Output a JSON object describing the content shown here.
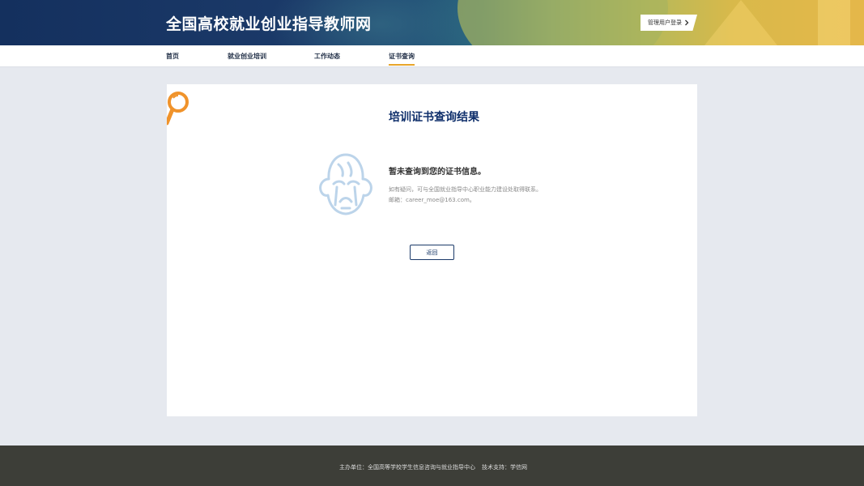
{
  "header": {
    "site_title": "全国高校就业创业指导教师网",
    "admin_login_label": "管理用户登录"
  },
  "nav": {
    "items": [
      {
        "label": "首页"
      },
      {
        "label": "就业创业培训"
      },
      {
        "label": "工作动态"
      },
      {
        "label": "证书查询"
      }
    ],
    "active": "证书查询"
  },
  "main": {
    "title": "培训证书查询结果",
    "no_result": "暂未查询到您的证书信息。",
    "help_line_1": "如有疑问，可与全国就业指导中心职业能力建设处取得联系。",
    "help_line_2": "邮箱：career_moe@163.com。",
    "back_label": "返回"
  },
  "footer": {
    "sponsor": "主办单位：全国高等学校学生信息咨询与就业指导中心",
    "support": "技术支持：学信网"
  },
  "colors": {
    "header_dark": "#14305e",
    "accent_gold": "#e8a52c",
    "title_blue": "#0f2f6b",
    "mascot_blue": "#bcd4ea",
    "magnifier_orange": "#f0932b",
    "footer_bg": "#3d3e38"
  },
  "icons": {
    "corner": "magnifier-icon",
    "mascot": "crying-mascot-icon",
    "chevron": "chevron-right-icon"
  }
}
